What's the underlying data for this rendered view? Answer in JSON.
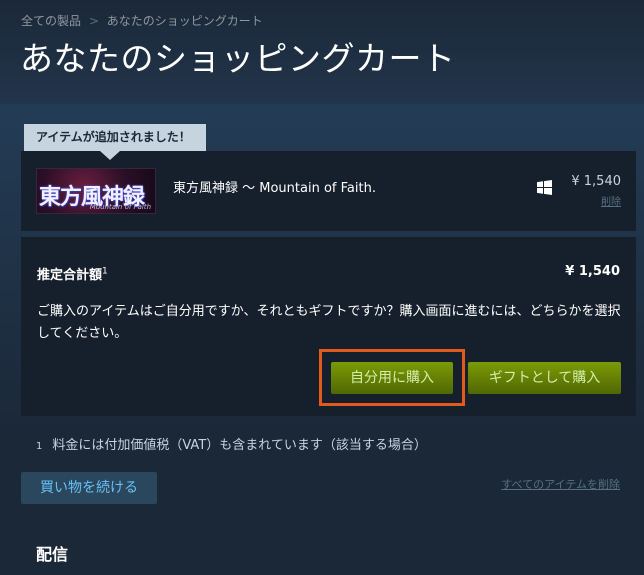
{
  "breadcrumb": {
    "root": "全ての製品",
    "separator": ">",
    "current": "あなたのショッピングカート"
  },
  "page_title": "あなたのショッピングカート",
  "notice": {
    "added_label": "アイテムが追加されました！"
  },
  "cart_item": {
    "capsule_text": "東方風神録",
    "capsule_subtitle": "Mountain of Faith",
    "name": "東方風神録 ～ Mountain of Faith.",
    "platform_icon": "windows-icon",
    "price": "¥ 1,540",
    "remove_label": "削除"
  },
  "summary": {
    "total_label": "推定合計額",
    "total_footnote_mark": "1",
    "total_value": "¥ 1,540",
    "question": "ご購入のアイテムはご自分用ですか、それともギフトですか？購入画面に進むには、どちらかを選択してください。",
    "buy_self_label": "自分用に購入",
    "buy_gift_label": "ギフトとして購入"
  },
  "footnote": {
    "mark": "1",
    "text": "料金には付加価値税（VAT）も含まれています（該当する場合）"
  },
  "actions": {
    "continue_label": "買い物を続ける",
    "remove_all_label": "すべてのアイテムを削除"
  },
  "delivery": {
    "title": "配信"
  },
  "colors": {
    "background": "#1b2838",
    "button_green": "#799905",
    "highlight": "#e45a1e",
    "link_blue": "#67c1f5"
  }
}
